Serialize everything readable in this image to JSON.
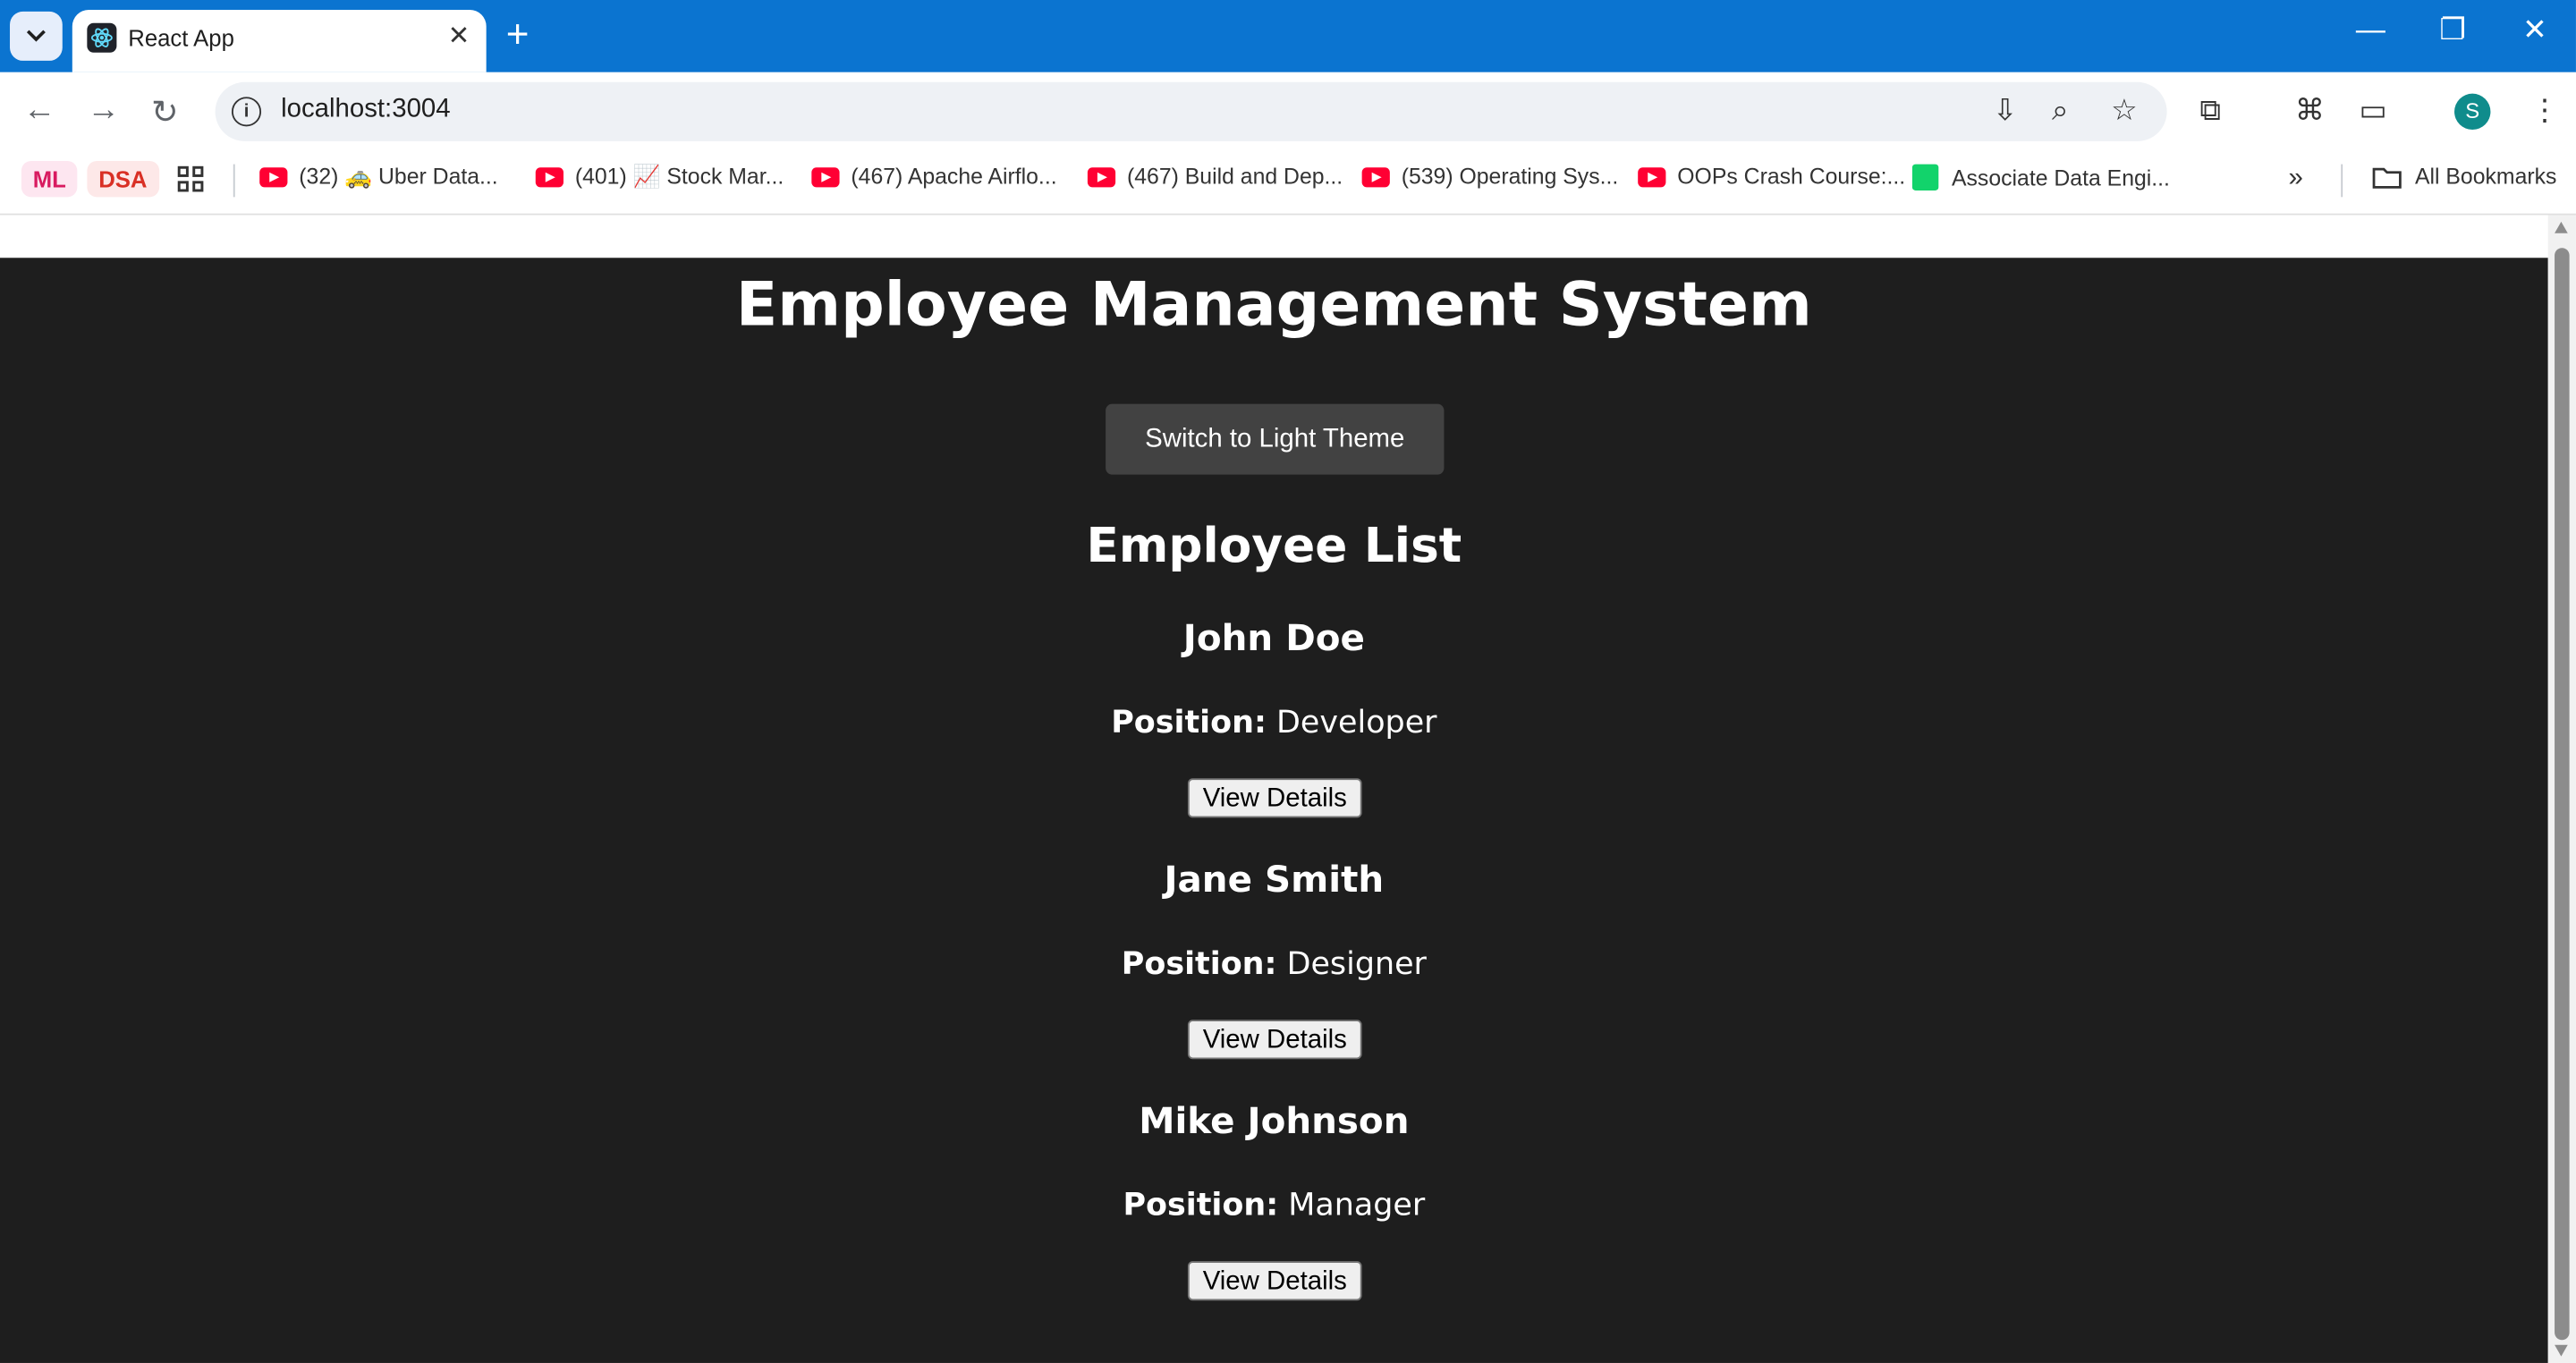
{
  "browser": {
    "tab_title": "React App",
    "url": "localhost:3004",
    "profile_initial": "S",
    "all_bookmarks_label": "All Bookmarks",
    "bookmarks": [
      {
        "label": "ML"
      },
      {
        "label": "DSA"
      },
      {
        "label": "(32) 🚕 Uber Data..."
      },
      {
        "label": "(401) 📈 Stock Mar..."
      },
      {
        "label": "(467) Apache Airflo..."
      },
      {
        "label": "(467) Build and Dep..."
      },
      {
        "label": "(539) Operating Sys..."
      },
      {
        "label": "OOPs Crash Course:..."
      },
      {
        "label": "Associate Data Engi..."
      }
    ]
  },
  "app": {
    "title": "Employee Management System",
    "theme_button": "Switch to Light Theme",
    "list_heading": "Employee List",
    "position_label": "Position:",
    "view_details_label": "View Details",
    "employees": [
      {
        "name": "John Doe",
        "position": "Developer"
      },
      {
        "name": "Jane Smith",
        "position": "Designer"
      },
      {
        "name": "Mike Johnson",
        "position": "Manager"
      }
    ]
  }
}
